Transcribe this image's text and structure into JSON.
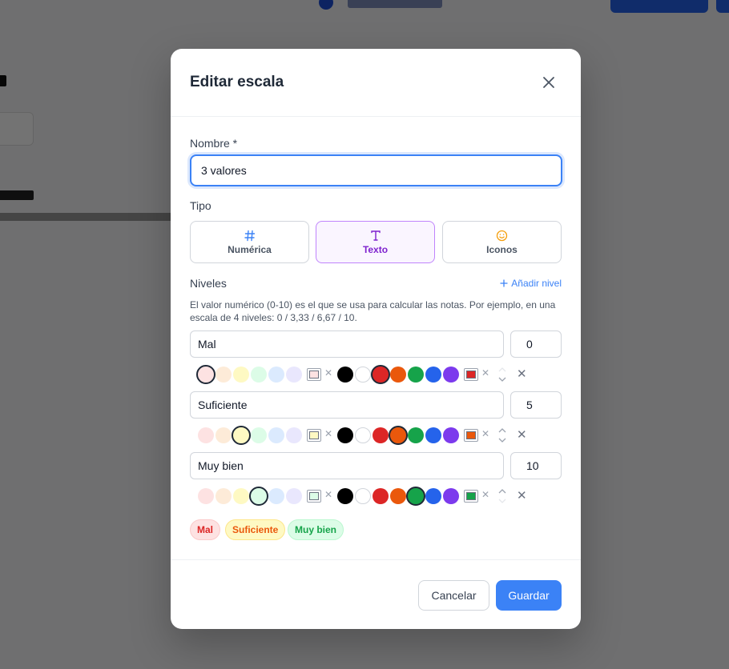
{
  "modal": {
    "title": "Editar escala",
    "name_label": "Nombre *",
    "name_value": "3 valores",
    "type_label": "Tipo",
    "types": [
      {
        "label": "Numérica",
        "icon": "hash-icon",
        "selected": false
      },
      {
        "label": "Texto",
        "icon": "text-icon",
        "selected": true
      },
      {
        "label": "Iconos",
        "icon": "smiley-icon",
        "selected": false
      }
    ],
    "levels_label": "Niveles",
    "add_level": "Añadir nivel",
    "help_text": "El valor numérico (0-10) es el que se usa para calcular las notas. Por ejemplo, en una escala de 4 niveles: 0 / 3,33 / 6,67 / 10.",
    "levels": [
      {
        "name": "Mal",
        "value": "0",
        "bg_selected": "#fde2e2",
        "text_selected": "#dc2626"
      },
      {
        "name": "Suficiente",
        "value": "5",
        "bg_selected": "#fef9c3",
        "text_selected": "#ea580c"
      },
      {
        "name": "Muy bien",
        "value": "10",
        "bg_selected": "#dcfce7",
        "text_selected": "#16a34a"
      }
    ],
    "preview": [
      {
        "label": "Mal",
        "bg": "#fde2e2",
        "color": "#dc2626"
      },
      {
        "label": "Suficiente",
        "bg": "#fef9c3",
        "color": "#ea580c"
      },
      {
        "label": "Muy bien",
        "bg": "#dcfce7",
        "color": "#16a34a"
      }
    ],
    "cancel": "Cancelar",
    "save": "Guardar"
  },
  "palette": {
    "bg": [
      "#fde2e2",
      "#fdebd8",
      "#fef9c3",
      "#dcfce7",
      "#dbeafe",
      "#e9e7fd"
    ],
    "text": [
      "#000000",
      "#ffffff",
      "#dc2626",
      "#ea580c",
      "#16a34a",
      "#2563eb",
      "#7c3aed"
    ]
  },
  "colors": {
    "accent": "#3b82f6",
    "selected_type_bg": "#faf5ff",
    "selected_type_text": "#7e22ce"
  }
}
